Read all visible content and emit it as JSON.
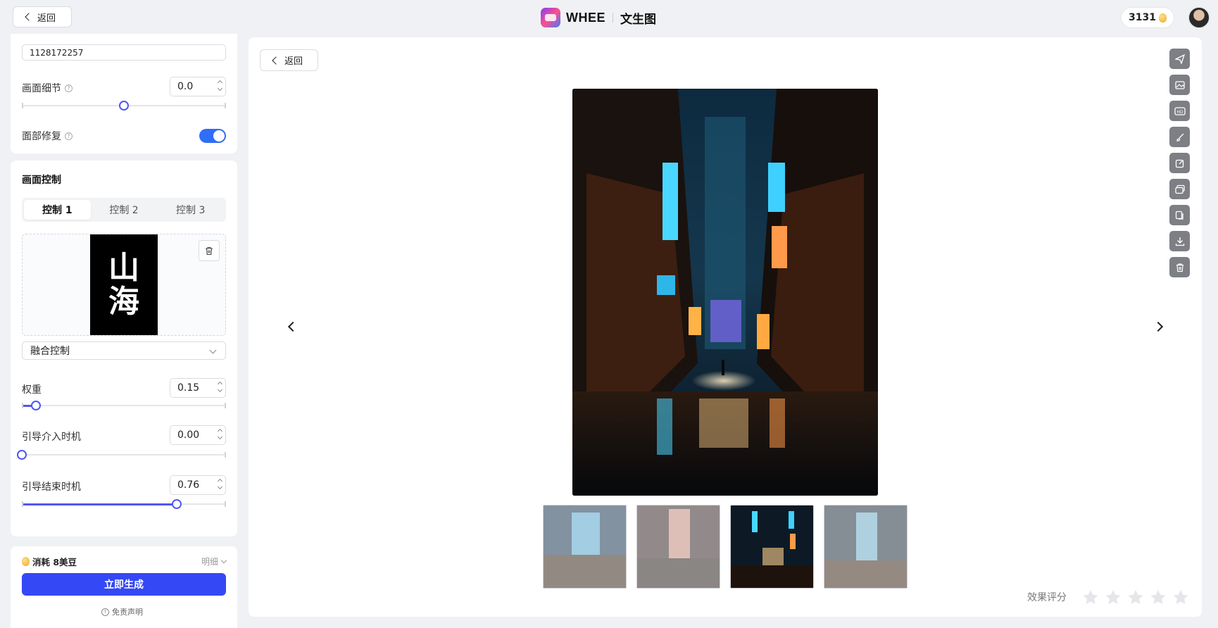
{
  "header": {
    "back_label": "返回",
    "brand_name": "WHEE",
    "brand_sub": "文生图",
    "credits": "3131"
  },
  "sidebar": {
    "seed_value": "1128172257",
    "detail": {
      "label": "画面细节",
      "value": "0.0",
      "level": 0.5
    },
    "face_fix": {
      "label": "面部修复",
      "enabled": true
    },
    "control_section_title": "画面控制",
    "control_tabs": [
      "控制 1",
      "控制 2",
      "控制 3"
    ],
    "active_tab": 0,
    "control_image_text": [
      "山",
      "海"
    ],
    "control_type": "融合控制",
    "weight": {
      "label": "权重",
      "value": "0.15",
      "level": 0.07
    },
    "guide_start": {
      "label": "引导介入时机",
      "value": "0.00",
      "level": 0.0
    },
    "guide_end": {
      "label": "引导结束时机",
      "value": "0.76",
      "level": 0.76
    },
    "cost_label": "消耗 8美豆",
    "detail_link": "明细",
    "generate_label": "立即生成",
    "disclaimer": "免责声明"
  },
  "main": {
    "back_label": "返回",
    "selected_thumb": 2,
    "rating_label": "效果评分",
    "star_count": 5,
    "tools": [
      "send-icon",
      "image-edit-icon",
      "hd-icon",
      "brush-icon",
      "edit-icon",
      "image-copy-icon",
      "duplicate-icon",
      "download-icon",
      "trash-icon"
    ]
  },
  "colors": {
    "accent": "#3448f5",
    "slider": "#4f57f2",
    "toggle": "#2f6ef6",
    "tool_bg": "#7d7f85"
  }
}
